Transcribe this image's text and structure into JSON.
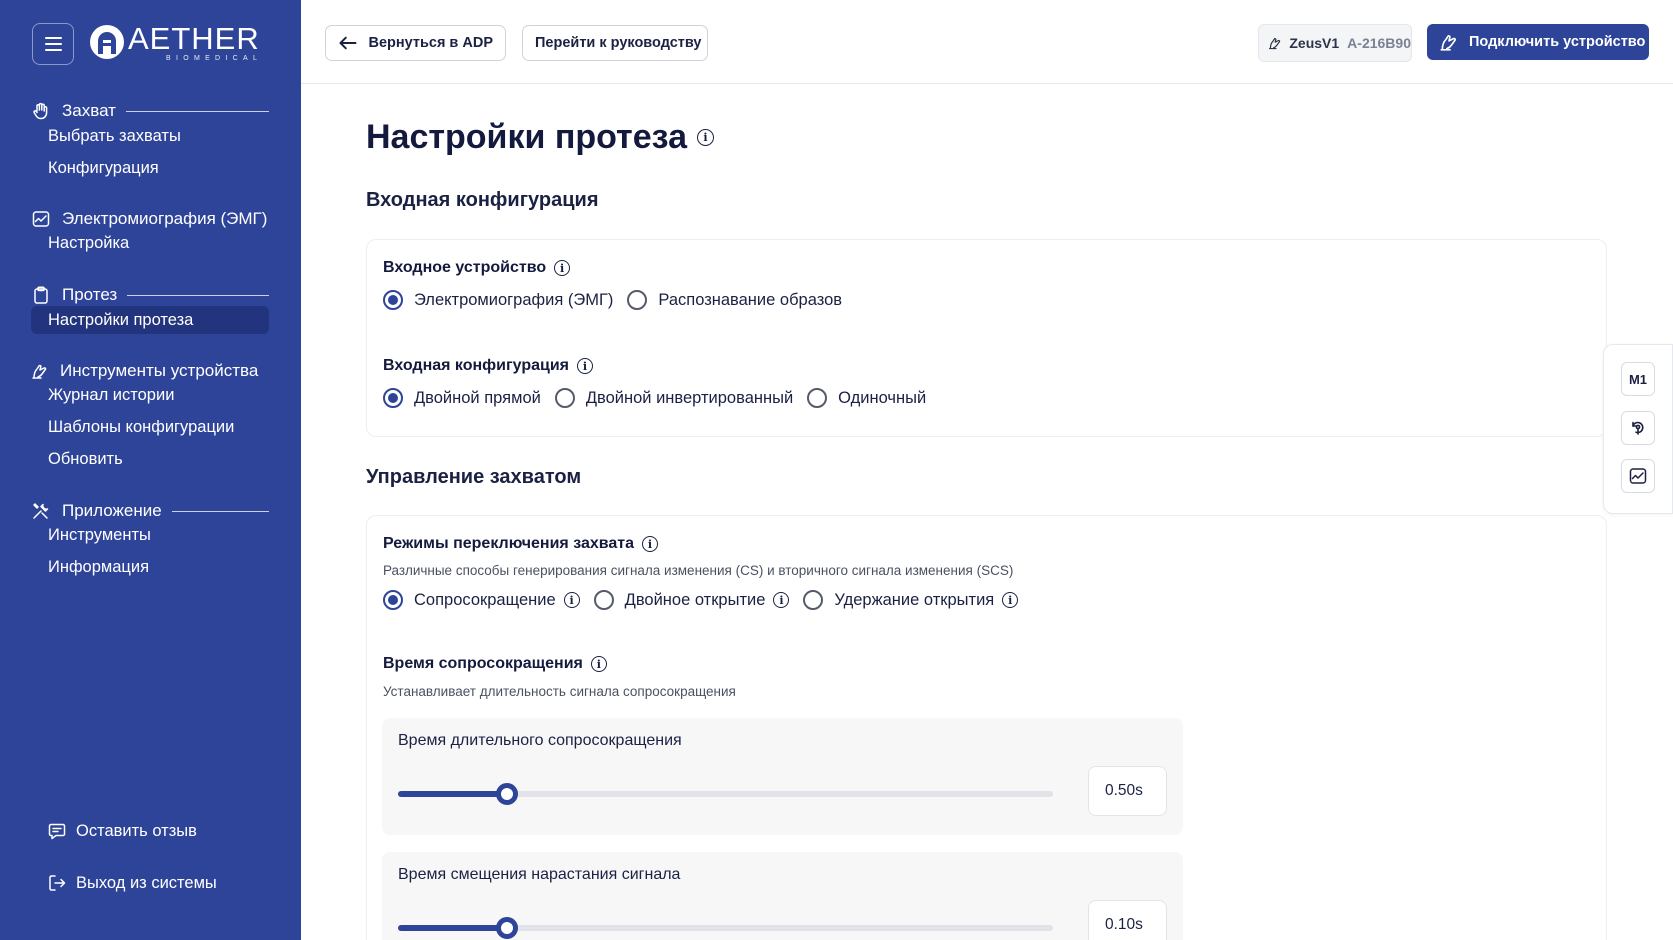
{
  "app": {
    "logo_name": "AETHER",
    "logo_sub": "BIOMEDICAL"
  },
  "sidebar": {
    "sections": [
      {
        "label": "Захват",
        "icon": "hand-icon",
        "items": [
          "Выбрать захваты",
          "Конфигурация"
        ]
      },
      {
        "label": "Электромиография (ЭМГ)",
        "icon": "chart-icon",
        "items": [
          "Настройка"
        ]
      },
      {
        "label": "Протез",
        "icon": "clipboard-icon",
        "items": [
          "Настройки протеза"
        ]
      },
      {
        "label": "Инструменты устройства",
        "icon": "prosthesis-icon",
        "items": [
          "Журнал истории",
          "Шаблоны конфигурации",
          "Обновить"
        ]
      },
      {
        "label": "Приложение",
        "icon": "tools-icon",
        "items": [
          "Инструменты",
          "Информация"
        ]
      }
    ],
    "active_item": "Настройки протеза",
    "feedback_label": "Оставить отзыв",
    "logout_label": "Выход из системы"
  },
  "header": {
    "back_label": "Вернуться в ADP",
    "guide_label": "Перейти к руководству",
    "device_name": "ZeusV1",
    "device_serial": "A-216B90",
    "connect_label": "Подключить устройство"
  },
  "main": {
    "title": "Настройки протеза",
    "input_section_title": "Входная конфигурация",
    "input_device": {
      "label": "Входное устройство",
      "options": [
        "Электромиография (ЭМГ)",
        "Распознавание образов"
      ],
      "selected": "Электромиография (ЭМГ)"
    },
    "input_config": {
      "label": "Входная конфигурация",
      "options": [
        "Двойной прямой",
        "Двойной инвертированный",
        "Одиночный"
      ],
      "selected": "Двойной прямой"
    },
    "grip_section_title": "Управление захватом",
    "switch_modes": {
      "label": "Режимы переключения захвата",
      "description": "Различные способы генерирования сигнала изменения (CS) и вторичного сигнала изменения (SCS)",
      "options": [
        "Сопросокращение",
        "Двойное открытие",
        "Удержание открытия"
      ],
      "selected": "Сопросокращение"
    },
    "cocontraction_time": {
      "label": "Время сопросокращения",
      "description": "Устанавливает длительность сигнала сопросокращения"
    },
    "sliders": [
      {
        "label": "Время длительного сопросокращения",
        "value_text": "0.50s",
        "fraction": 0.167
      },
      {
        "label": "Время смещения нарастания сигнала",
        "value_text": "0.10s",
        "fraction": 0.167
      }
    ]
  },
  "side_tools": {
    "mode_label": "M1"
  },
  "colors": {
    "sidebar_bg": "#2e4499",
    "accent": "#2e4499",
    "active_item_bg": "#22347d"
  }
}
